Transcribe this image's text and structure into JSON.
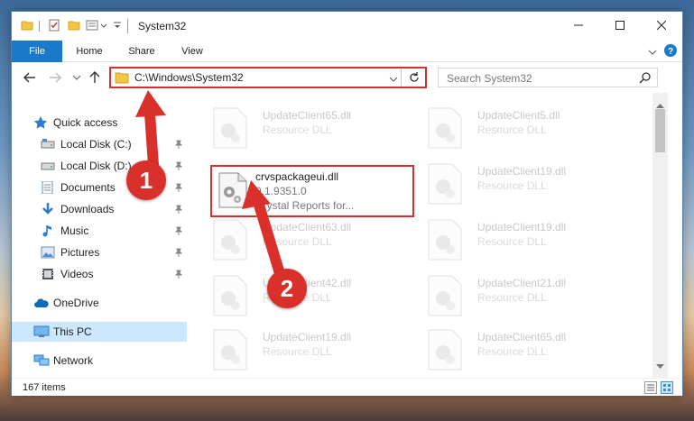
{
  "window": {
    "title": "System32"
  },
  "ribbon": {
    "tabs": [
      "File",
      "Home",
      "Share",
      "View"
    ]
  },
  "address": {
    "path": "C:\\Windows\\System32"
  },
  "search": {
    "placeholder": "Search System32"
  },
  "sidebar": {
    "items": [
      {
        "label": "Quick access",
        "icon": "star-icon"
      },
      {
        "label": "Local Disk (C:)",
        "icon": "drive-icon",
        "pinned": true
      },
      {
        "label": "Local Disk (D:)",
        "icon": "drive-icon",
        "pinned": true
      },
      {
        "label": "Documents",
        "icon": "documents-icon",
        "pinned": true
      },
      {
        "label": "Downloads",
        "icon": "download-icon",
        "pinned": true
      },
      {
        "label": "Music",
        "icon": "music-icon",
        "pinned": true
      },
      {
        "label": "Pictures",
        "icon": "pictures-icon",
        "pinned": true
      },
      {
        "label": "Videos",
        "icon": "videos-icon",
        "pinned": true
      },
      {
        "label": "OneDrive",
        "icon": "cloud-icon"
      },
      {
        "label": "This PC",
        "icon": "computer-icon",
        "selected": true
      },
      {
        "label": "Network",
        "icon": "network-icon"
      }
    ]
  },
  "files": [
    {
      "name": "UpdateClient65.dll",
      "type": "Resource DLL"
    },
    {
      "name": "UpdateClient5.dll",
      "type": "Resource DLL"
    },
    {
      "name": "UpdateClient19.dll",
      "type": "Resource DLL"
    },
    {
      "name": "UpdateClient63.dll",
      "type": "Resource DLL"
    },
    {
      "name": "UpdateClient19.dll",
      "type": "Resource DLL"
    },
    {
      "name": "UpdateClient42.dll",
      "type": "Resource DLL"
    },
    {
      "name": "UpdateClient21.dll",
      "type": "Resource DLL"
    },
    {
      "name": "UpdateClient19.dll",
      "type": "Resource DLL"
    },
    {
      "name": "UpdateClient65.dll",
      "type": "Resource DLL"
    }
  ],
  "highlighted_file": {
    "name": "crvspackageui.dll",
    "version": "9.1.9351.0",
    "description": "Crystal Reports for..."
  },
  "status": {
    "item_count": "167 items"
  },
  "annotations": {
    "step1": "1",
    "step2": "2"
  },
  "colors": {
    "accent": "#1979ca",
    "highlight": "#d9302b",
    "selected": "#cce8ff"
  }
}
